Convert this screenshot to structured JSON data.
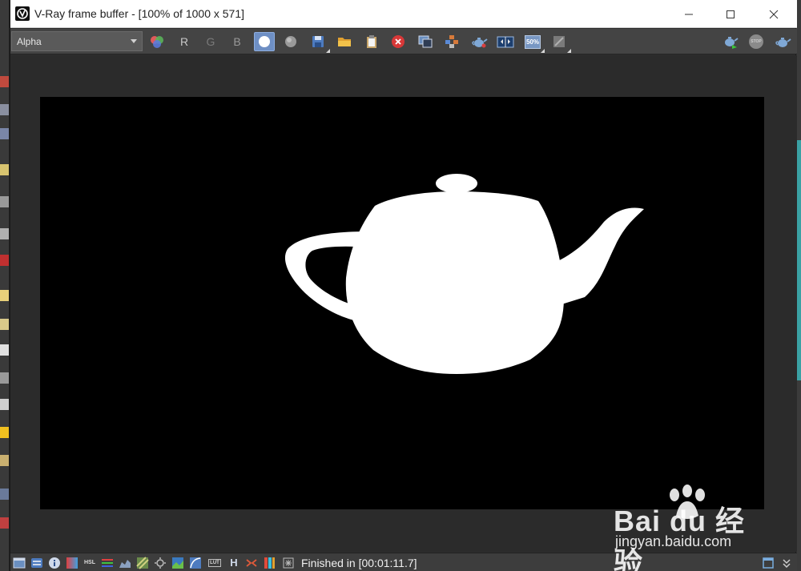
{
  "window": {
    "title": "V-Ray frame buffer - [100% of 1000 x 571]",
    "controls": [
      "minimize",
      "maximize",
      "close"
    ]
  },
  "toolbar": {
    "channel_selected": "Alpha",
    "channel_buttons": [
      "R",
      "G",
      "B"
    ],
    "zoom_label": "50%",
    "lut_label": "LUT",
    "stop_label": "STOP",
    "icons": [
      "color-balls-icon",
      "white-circle-icon",
      "gray-circle-icon",
      "save-icon",
      "open-folder-icon",
      "clipboard-icon",
      "clear-icon",
      "duplicate-icon",
      "region-icon",
      "render-teapot-icon",
      "compare-icon",
      "zoom-50-icon",
      "lens-effects-icon",
      "render-interactive-icon",
      "stop-icon",
      "render-teapot-right-icon"
    ]
  },
  "statusbar": {
    "status": "Finished in [00:01:11.7]",
    "hsl_label": "HSL",
    "h_label": "H"
  },
  "watermark": {
    "logo": "Bai du 经验",
    "url": "jingyan.baidu.com"
  }
}
